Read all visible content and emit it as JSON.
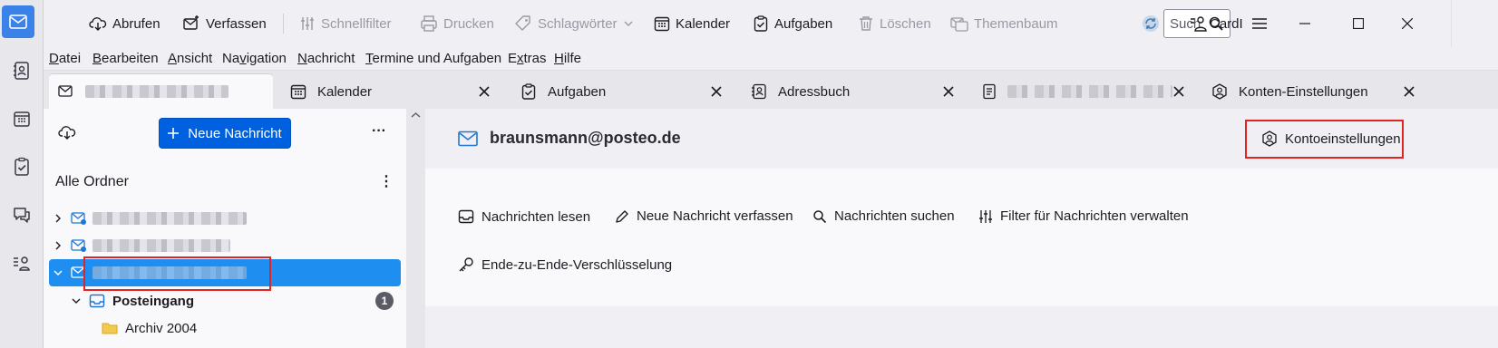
{
  "spaces": {
    "items": [
      {
        "icon": "mail-icon",
        "active": true
      },
      {
        "icon": "address-book-icon"
      },
      {
        "icon": "calendar-icon"
      },
      {
        "icon": "tasks-icon"
      },
      {
        "icon": "chat-icon"
      },
      {
        "icon": "contacts-list-icon"
      }
    ]
  },
  "toolbar": {
    "get_messages": "Abrufen",
    "write": "Verfassen",
    "quick_filter": "Schnellfilter",
    "print": "Drucken",
    "tags": "Schlagwörter",
    "calendar": "Kalender",
    "tasks": "Aufgaben",
    "delete": "Löschen",
    "thread_tree": "Themenbaum",
    "search_placeholder": "Such",
    "cardbook": "CardI"
  },
  "menubar": {
    "items": [
      {
        "accel": "D",
        "rest": "atei"
      },
      {
        "accel": "B",
        "rest": "earbeiten"
      },
      {
        "accel": "A",
        "rest": "nsicht"
      },
      {
        "pre": "Na",
        "accel": "v",
        "rest": "igation"
      },
      {
        "accel": "N",
        "rest": "achricht"
      },
      {
        "accel": "T",
        "rest": "ermine und Aufgaben"
      },
      {
        "pre": "E",
        "accel": "x",
        "rest": "tras"
      },
      {
        "accel": "H",
        "rest": "ilfe"
      }
    ]
  },
  "tabs": [
    {
      "label": ""
    },
    {
      "label": "Kalender"
    },
    {
      "label": "Aufgaben"
    },
    {
      "label": "Adressbuch"
    },
    {
      "label": ""
    },
    {
      "label": "Konten-Einstellungen"
    }
  ],
  "folder_pane": {
    "new_message": "Neue Nachricht",
    "more": "···",
    "header": "Alle Ordner",
    "header_more": "⋮",
    "inbox": "Posteingang",
    "inbox_unread": "1",
    "archive": "Archiv 2004"
  },
  "account": {
    "email": "braunsmann@posteo.de",
    "settings_button": "Kontoeinstellungen",
    "actions": {
      "read": "Nachrichten lesen",
      "compose": "Neue Nachricht verfassen",
      "search": "Nachrichten suchen",
      "filters": "Filter für Nachrichten verwalten",
      "e2e": "Ende-zu-Ende-Verschlüsselung"
    }
  },
  "colors": {
    "accent": "#0061e0",
    "selection": "#1f8ef1",
    "highlight_box": "#e02424"
  }
}
